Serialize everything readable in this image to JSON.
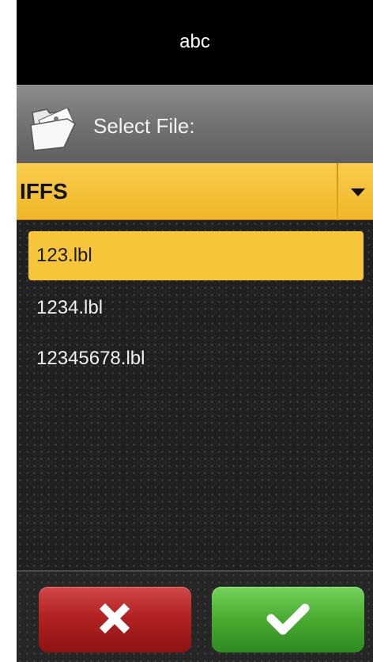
{
  "window": {
    "title": "abc"
  },
  "header": {
    "label": "Select File:",
    "icon": "folder-open-icon"
  },
  "dropdown": {
    "value": "IFFS",
    "icon": "caret-down-icon"
  },
  "files": [
    {
      "name": "123.lbl",
      "selected": true
    },
    {
      "name": "1234.lbl",
      "selected": false
    },
    {
      "name": "12345678.lbl",
      "selected": false
    }
  ],
  "footer": {
    "cancel_icon": "cross-icon",
    "ok_icon": "checkmark-icon"
  },
  "colors": {
    "selected": "#f6c53a",
    "dropdown": "#f3bd32",
    "cancel": "#b32222",
    "ok": "#4cae34"
  }
}
